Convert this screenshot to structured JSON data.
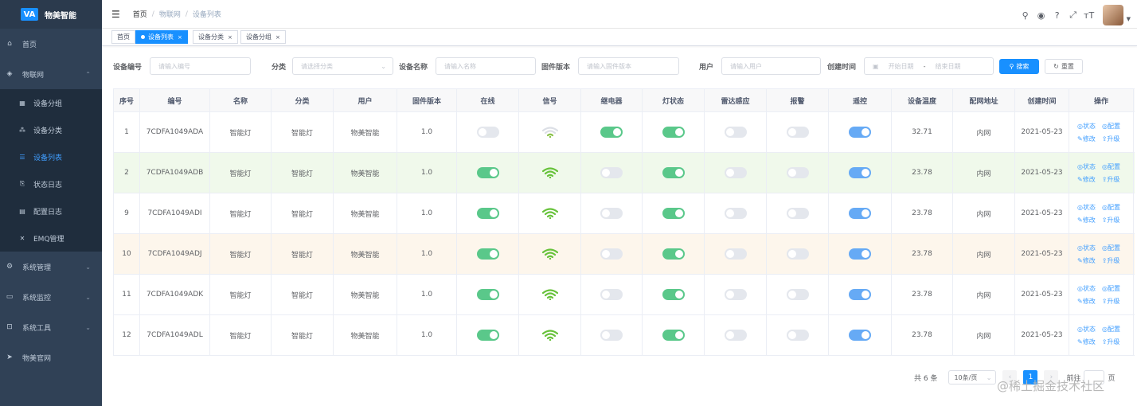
{
  "app": {
    "logo_mark": "VA",
    "title": "物美智能"
  },
  "sidebar": {
    "items": [
      {
        "icon": "⌂",
        "label": "首页",
        "arrow": ""
      },
      {
        "icon": "◈",
        "label": "物联网",
        "arrow": "⌃"
      },
      {
        "icon": "▦",
        "label": "设备分组",
        "sub": true
      },
      {
        "icon": "⁂",
        "label": "设备分类",
        "sub": true
      },
      {
        "icon": "☰",
        "label": "设备列表",
        "sub": true,
        "active": true
      },
      {
        "icon": "⎘",
        "label": "状态日志",
        "sub": true
      },
      {
        "icon": "▤",
        "label": "配置日志",
        "sub": true
      },
      {
        "icon": "✕",
        "label": "EMQ管理",
        "sub": true
      },
      {
        "icon": "⚙",
        "label": "系统管理",
        "arrow": "⌄"
      },
      {
        "icon": "▭",
        "label": "系统监控",
        "arrow": "⌄"
      },
      {
        "icon": "⊡",
        "label": "系统工具",
        "arrow": "⌄"
      },
      {
        "icon": "➤",
        "label": "物美官网",
        "arrow": ""
      }
    ]
  },
  "navbar": {
    "breadcrumb": [
      "首页",
      "物联网",
      "设备列表"
    ],
    "separator": "/",
    "icons": [
      "search-icon",
      "github-icon",
      "question-icon",
      "fullscreen-icon",
      "font-size-icon"
    ]
  },
  "tags": [
    {
      "label": "首页",
      "active": false
    },
    {
      "label": "设备列表",
      "active": true,
      "close": "×"
    },
    {
      "label": "设备分类",
      "active": false,
      "close": "×"
    },
    {
      "label": "设备分组",
      "active": false,
      "close": "×"
    }
  ],
  "search": {
    "device_no_label": "设备编号",
    "device_no_placeholder": "请输入编号",
    "category_label": "分类",
    "category_placeholder": "请选择分类",
    "device_name_label": "设备名称",
    "device_name_placeholder": "请输入名称",
    "firmware_label": "固件版本",
    "firmware_placeholder": "请输入固件版本",
    "user_label": "用户",
    "user_placeholder": "请输入用户",
    "created_label": "创建时间",
    "start_placeholder": "开始日期",
    "range_sep": "-",
    "end_placeholder": "结束日期",
    "search_btn": "搜索",
    "reset_btn": "重置"
  },
  "table": {
    "headers": [
      "序号",
      "编号",
      "名称",
      "分类",
      "用户",
      "固件版本",
      "在线",
      "信号",
      "继电器",
      "灯状态",
      "雷达感应",
      "报警",
      "遥控",
      "设备温度",
      "配网地址",
      "创建时间",
      "操作"
    ],
    "rows": [
      {
        "seq": "1",
        "code": "7CDFA1049ADA",
        "name": "智能灯",
        "category": "智能灯",
        "user": "物美智能",
        "fw": "1.0",
        "online": false,
        "signal": "weak",
        "relay": true,
        "light": true,
        "radar": false,
        "alarm": false,
        "remote": true,
        "temp": "32.71",
        "net": "内网",
        "created": "2021-05-23",
        "bg": ""
      },
      {
        "seq": "2",
        "code": "7CDFA1049ADB",
        "name": "智能灯",
        "category": "智能灯",
        "user": "物美智能",
        "fw": "1.0",
        "online": true,
        "signal": "strong",
        "relay": false,
        "light": true,
        "radar": false,
        "alarm": false,
        "remote": true,
        "temp": "23.78",
        "net": "内网",
        "created": "2021-05-23",
        "bg": "green"
      },
      {
        "seq": "9",
        "code": "7CDFA1049ADI",
        "name": "智能灯",
        "category": "智能灯",
        "user": "物美智能",
        "fw": "1.0",
        "online": true,
        "signal": "strong",
        "relay": false,
        "light": true,
        "radar": false,
        "alarm": false,
        "remote": true,
        "temp": "23.78",
        "net": "内网",
        "created": "2021-05-23",
        "bg": ""
      },
      {
        "seq": "10",
        "code": "7CDFA1049ADJ",
        "name": "智能灯",
        "category": "智能灯",
        "user": "物美智能",
        "fw": "1.0",
        "online": true,
        "signal": "strong",
        "relay": false,
        "light": true,
        "radar": false,
        "alarm": false,
        "remote": true,
        "temp": "23.78",
        "net": "内网",
        "created": "2021-05-23",
        "bg": "orange"
      },
      {
        "seq": "11",
        "code": "7CDFA1049ADK",
        "name": "智能灯",
        "category": "智能灯",
        "user": "物美智能",
        "fw": "1.0",
        "online": true,
        "signal": "strong",
        "relay": false,
        "light": true,
        "radar": false,
        "alarm": false,
        "remote": true,
        "temp": "23.78",
        "net": "内网",
        "created": "2021-05-23",
        "bg": ""
      },
      {
        "seq": "12",
        "code": "7CDFA1049ADL",
        "name": "智能灯",
        "category": "智能灯",
        "user": "物美智能",
        "fw": "1.0",
        "online": true,
        "signal": "strong",
        "relay": false,
        "light": true,
        "radar": false,
        "alarm": false,
        "remote": true,
        "temp": "23.78",
        "net": "内网",
        "created": "2021-05-23",
        "bg": ""
      }
    ],
    "ops": {
      "status": "◎状态",
      "config": "◎配置",
      "edit": "✎修改",
      "upgrade": "⇪升级"
    }
  },
  "pagination": {
    "total": "共 6 条",
    "size": "10条/页",
    "page": "1",
    "goto": "前往",
    "unit": "页"
  },
  "watermark": "@稀土掘金技术社区",
  "colors": {
    "accent": "#1890ff",
    "switch_green": "#5ac88a",
    "switch_blue": "#66aaf5"
  }
}
